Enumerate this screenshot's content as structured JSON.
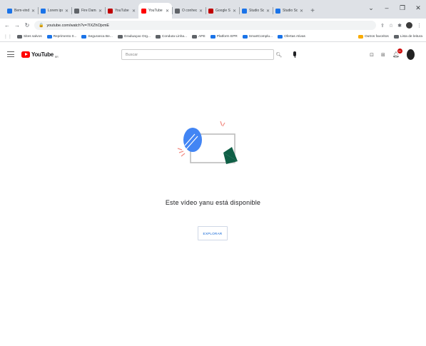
{
  "browser": {
    "tabs": [
      {
        "title": "Bem-vindo ao...",
        "color": "#1a73e8"
      },
      {
        "title": "Lorem ipsu...",
        "color": "#1a73e8"
      },
      {
        "title": "Fire Damage...",
        "color": "#5f6368"
      },
      {
        "title": "YouTube Stu...",
        "color": "#c00000"
      },
      {
        "title": "YouTube",
        "color": "#ff0000",
        "active": true
      },
      {
        "title": "O conhecim...",
        "color": "#5f6368"
      },
      {
        "title": "Google Studio...",
        "color": "#c00000"
      },
      {
        "title": "Studio Scri...",
        "color": "#1a73e8"
      },
      {
        "title": "Studio Scri...",
        "color": "#1a73e8"
      }
    ],
    "new_tab_glyph": "+",
    "window_controls": [
      "⌄",
      "–",
      "❐",
      "✕"
    ],
    "url": "youtube.com/watch?v=7IXZhOjxmE",
    "bookmarks": [
      {
        "label": "Sites salvos",
        "color": "#5f6368"
      },
      {
        "label": "Reprimento 0...",
        "color": "#1a73e8"
      },
      {
        "label": "Seguranca Be...",
        "color": "#1a73e8"
      },
      {
        "label": "Graduaçao Org...",
        "color": "#5f6368"
      },
      {
        "label": "Conduta Linha...",
        "color": "#5f6368"
      },
      {
        "label": "APE",
        "color": "#5f6368"
      },
      {
        "label": "Platform EPR",
        "color": "#1a73e8"
      },
      {
        "label": "SmartComplu...",
        "color": "#1a73e8"
      },
      {
        "label": "Ofertas Ativas",
        "color": "#1a73e8"
      }
    ],
    "bookmarks_right": [
      {
        "label": "Outros favoritos",
        "color": "#f9ab00"
      },
      {
        "label": "Lista de leitura",
        "color": "#5f6368"
      }
    ]
  },
  "youtube": {
    "logo_text": "YouTube",
    "logo_region": "BR",
    "search_placeholder": "Buscar",
    "notifications_count": "9+"
  },
  "message": {
    "text": "Este vídeo yanu está disponible",
    "button_label": "EXPLORAR"
  },
  "colors": {
    "brand_red": "#ff0000",
    "illustration_blue": "#4285f4",
    "illustration_green": "#0f5f46",
    "illustration_pink": "#f28b82",
    "link_blue": "#065fd4"
  }
}
